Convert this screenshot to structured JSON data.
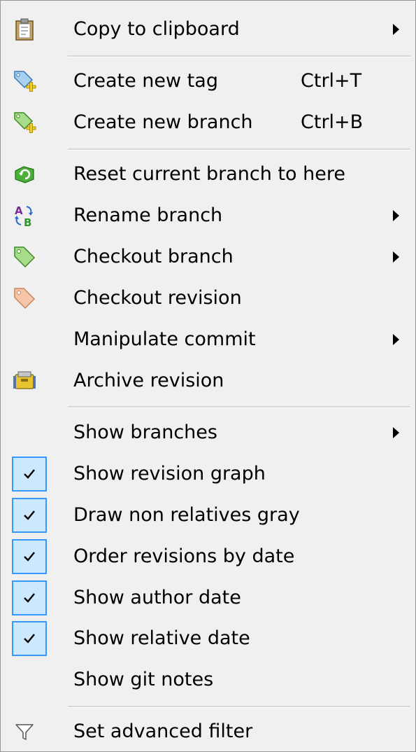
{
  "menu": {
    "items": [
      {
        "label": "Copy to clipboard",
        "icon": "clipboard-icon",
        "submenu": true
      },
      {
        "label": "Create new tag",
        "shortcut": "Ctrl+T",
        "icon": "create-tag-icon"
      },
      {
        "label": "Create new branch",
        "shortcut": "Ctrl+B",
        "icon": "create-branch-icon"
      },
      {
        "label": "Reset current branch to here",
        "icon": "reset-icon"
      },
      {
        "label": "Rename branch",
        "icon": "rename-icon",
        "submenu": true
      },
      {
        "label": "Checkout branch",
        "icon": "checkout-branch-icon",
        "submenu": true
      },
      {
        "label": "Checkout revision",
        "icon": "checkout-revision-icon"
      },
      {
        "label": "Manipulate commit",
        "submenu": true
      },
      {
        "label": "Archive revision",
        "icon": "archive-icon"
      },
      {
        "label": "Show branches",
        "submenu": true
      },
      {
        "label": "Show revision graph",
        "checked": true
      },
      {
        "label": "Draw non relatives gray",
        "checked": true
      },
      {
        "label": "Order revisions by date",
        "checked": true
      },
      {
        "label": "Show author date",
        "checked": true
      },
      {
        "label": "Show relative date",
        "checked": true
      },
      {
        "label": "Show git notes",
        "checked": false
      },
      {
        "label": "Set advanced filter",
        "icon": "filter-icon"
      }
    ],
    "rename_icon_text": {
      "top": "A",
      "bottom": "B"
    }
  },
  "colors": {
    "menu_background": "#f0f0f0",
    "check_fill": "#cce8ff",
    "check_border": "#3399ff",
    "separator": "#d7d7d7"
  }
}
